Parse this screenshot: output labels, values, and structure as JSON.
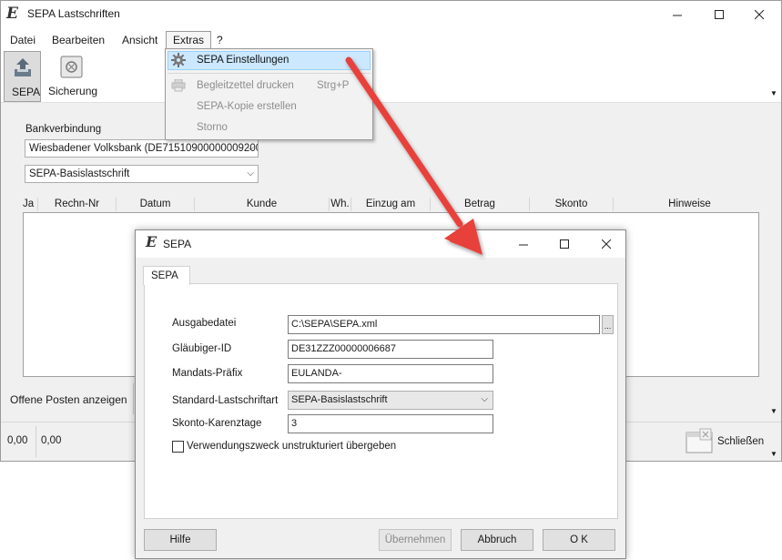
{
  "main_window": {
    "title": "SEPA Lastschriften",
    "menu": [
      "Datei",
      "Bearbeiten",
      "Ansicht",
      "Extras",
      "?"
    ],
    "ribbon": {
      "sepa_label": "SEPA",
      "backup_label": "Sicherung"
    },
    "bank_label": "Bankverbindung",
    "bank_value": "Wiesbadener Volksbank  (DE71510900000009200",
    "type_value": "SEPA-Basislastschrift",
    "columns": [
      "Ja",
      "Rechn-Nr",
      "Datum",
      "Kunde",
      "Wh.",
      "Einzug am",
      "Betrag",
      "Skonto",
      "Hinweise"
    ],
    "open_items_button": "Offene Posten anzeigen",
    "total1": "0,00",
    "total2": "0,00",
    "close_button": "Schließen"
  },
  "extras_menu": {
    "items": [
      {
        "label": "SEPA Einstellungen",
        "shortcut": "",
        "enabled": true,
        "highlighted": true
      },
      {
        "label": "Begleitzettel drucken",
        "shortcut": "Strg+P",
        "enabled": false
      },
      {
        "label": "SEPA-Kopie erstellen",
        "shortcut": "",
        "enabled": false
      },
      {
        "label": "Storno",
        "shortcut": "",
        "enabled": false
      }
    ]
  },
  "dialog": {
    "title": "SEPA",
    "tab": "SEPA",
    "fields": {
      "output_file": {
        "label": "Ausgabedatei",
        "value": "C:\\SEPA\\SEPA.xml",
        "browse": "..."
      },
      "creditor_id": {
        "label": "Gläubiger-ID",
        "value": "DE31ZZZ00000006687"
      },
      "mandate_prefix": {
        "label": "Mandats-Präfix",
        "value": "EULANDA-"
      },
      "default_type": {
        "label": "Standard-Lastschriftart",
        "value": "SEPA-Basislastschrift"
      },
      "discount_days": {
        "label": "Skonto-Karenztage",
        "value": "3"
      }
    },
    "checkbox_label": "Verwendungszweck unstrukturiert übergeben",
    "checkbox_checked": false,
    "buttons": {
      "help": "Hilfe",
      "apply": "Übernehmen",
      "cancel": "Abbruch",
      "ok": "O K"
    }
  },
  "colors": {
    "annotation_arrow": "#e8413a",
    "menu_highlight": "#cce8ff",
    "window_bg": "#f0f0f0"
  }
}
